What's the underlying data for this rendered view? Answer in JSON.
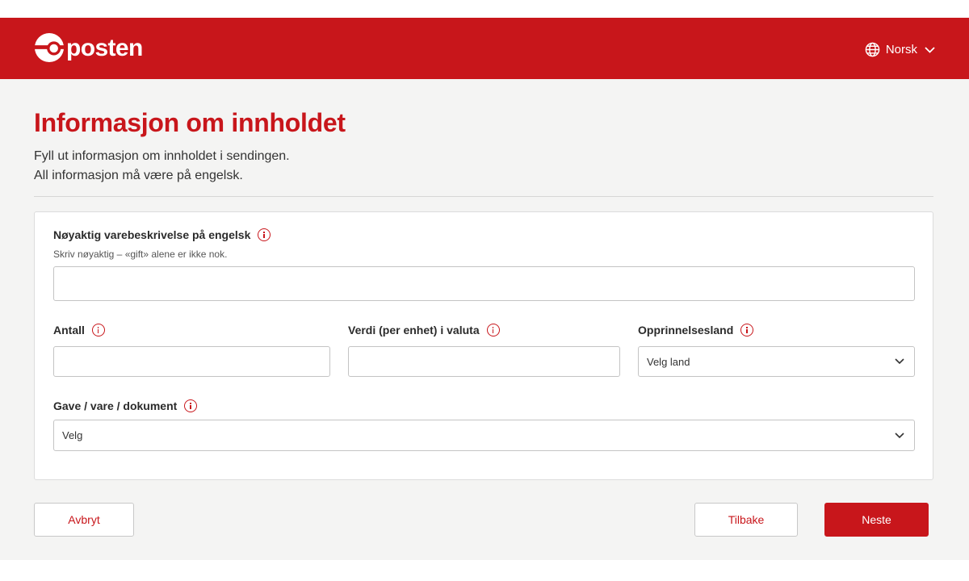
{
  "header": {
    "brand": "posten",
    "language": "Norsk"
  },
  "page": {
    "title": "Informasjon om innholdet",
    "intro_line1": "Fyll ut informasjon om innholdet i sendingen.",
    "intro_line2": "All informasjon må være på engelsk."
  },
  "form": {
    "description": {
      "label": "Nøyaktig varebeskrivelse på engelsk",
      "helper": "Skriv nøyaktig – «gift» alene er ikke nok.",
      "value": ""
    },
    "quantity": {
      "label": "Antall",
      "value": ""
    },
    "value_per_unit": {
      "label": "Verdi (per enhet) i valuta",
      "value": ""
    },
    "origin_country": {
      "label": "Opprinnelsesland",
      "selected": "Velg land"
    },
    "category": {
      "label": "Gave / vare / dokument",
      "selected": "Velg"
    }
  },
  "actions": {
    "cancel": "Avbryt",
    "back": "Tilbake",
    "next": "Neste"
  },
  "colors": {
    "brand_red": "#c8161b",
    "page_background": "#f4f4f3"
  },
  "icons": {
    "language": "globe-icon",
    "dropdown": "chevron-down-icon",
    "info": "info-icon"
  }
}
